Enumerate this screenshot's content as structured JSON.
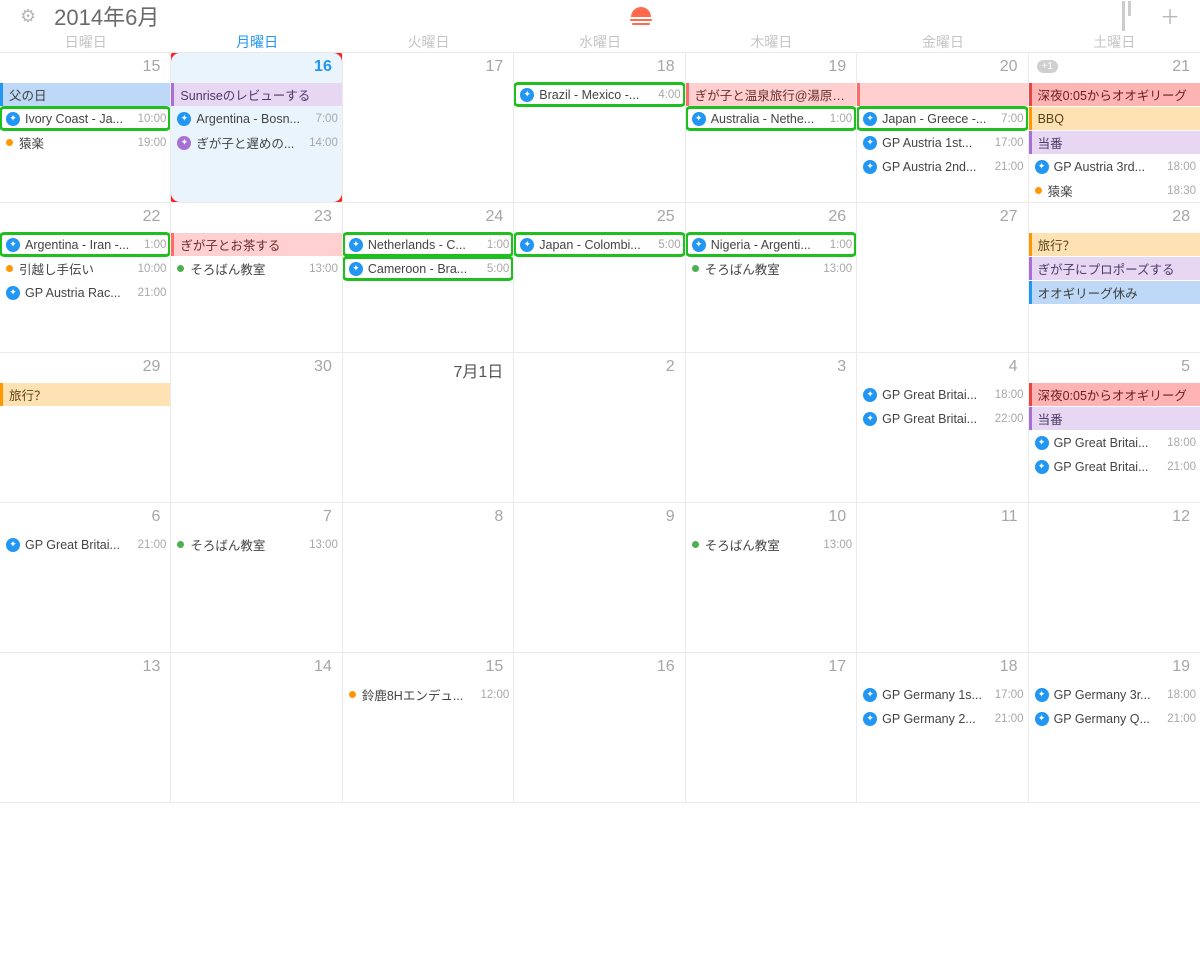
{
  "title": "2014年6月",
  "weekdays": [
    "日曜日",
    "月曜日",
    "火曜日",
    "水曜日",
    "木曜日",
    "金曜日",
    "土曜日"
  ],
  "activeWeekdayIndex": 1,
  "cells": [
    {
      "num": "15",
      "events": [
        {
          "style": "bar-blue",
          "title": "父の日"
        },
        {
          "style": "hl-green",
          "icon": "ic-blue",
          "title": "Ivory Coast - Ja...",
          "time": "10:00"
        },
        {
          "dot": "d-orange",
          "title": "猿楽",
          "time": "19:00"
        }
      ]
    },
    {
      "num": "16",
      "today": true,
      "events": [
        {
          "style": "bar-purple",
          "title": "Sunriseのレビューする"
        },
        {
          "icon": "ic-blue",
          "title": "Argentina - Bosn...",
          "time": "7:00"
        },
        {
          "icon": "ic-purple",
          "title": "ぎが子と遅めの...",
          "time": "14:00"
        }
      ]
    },
    {
      "num": "17",
      "events": []
    },
    {
      "num": "18",
      "events": [
        {
          "style": "hl-green",
          "icon": "ic-blue",
          "title": "Brazil - Mexico -...",
          "time": "4:00"
        }
      ]
    },
    {
      "num": "19",
      "events": [
        {
          "style": "bar-pink",
          "title": "ぎが子と温泉旅行@湯原温泉"
        },
        {
          "style": "hl-green",
          "icon": "ic-blue",
          "title": "Australia - Nethe...",
          "time": "1:00"
        }
      ]
    },
    {
      "num": "20",
      "events": [
        {
          "style": "bar-pink",
          "title": " ",
          "span": true
        },
        {
          "style": "hl-green",
          "icon": "ic-blue",
          "title": "Japan - Greece -...",
          "time": "7:00"
        },
        {
          "icon": "ic-blue",
          "title": "GP Austria 1st...",
          "time": "17:00"
        },
        {
          "icon": "ic-blue",
          "title": "GP Austria 2nd...",
          "time": "21:00"
        }
      ]
    },
    {
      "num": "21",
      "overflow": "+1",
      "events": [
        {
          "style": "bar-red",
          "title": "深夜0:05からオオギリーグ"
        },
        {
          "style": "bar-orange",
          "title": "BBQ"
        },
        {
          "style": "bar-purple",
          "title": "当番"
        },
        {
          "icon": "ic-blue",
          "title": "GP Austria 3rd...",
          "time": "18:00"
        },
        {
          "dot": "d-orange",
          "title": "猿楽",
          "time": "18:30"
        }
      ]
    },
    {
      "num": "22",
      "events": [
        {
          "style": "hl-green",
          "icon": "ic-blue",
          "title": "Argentina - Iran -...",
          "time": "1:00"
        },
        {
          "dot": "d-orange",
          "title": "引越し手伝い",
          "time": "10:00"
        },
        {
          "icon": "ic-blue",
          "title": "GP Austria Rac...",
          "time": "21:00"
        }
      ]
    },
    {
      "num": "23",
      "events": [
        {
          "style": "bar-pink",
          "title": "ぎが子とお茶する"
        },
        {
          "dot": "d-green",
          "title": "そろばん教室",
          "time": "13:00"
        }
      ]
    },
    {
      "num": "24",
      "events": [
        {
          "style": "hl-green",
          "icon": "ic-blue",
          "title": "Netherlands - C...",
          "time": "1:00"
        },
        {
          "style": "hl-green",
          "icon": "ic-blue",
          "title": "Cameroon - Bra...",
          "time": "5:00"
        }
      ]
    },
    {
      "num": "25",
      "events": [
        {
          "style": "hl-green",
          "icon": "ic-blue",
          "title": "Japan - Colombi...",
          "time": "5:00"
        }
      ]
    },
    {
      "num": "26",
      "events": [
        {
          "style": "hl-green",
          "icon": "ic-blue",
          "title": "Nigeria - Argenti...",
          "time": "1:00"
        },
        {
          "dot": "d-green",
          "title": "そろばん教室",
          "time": "13:00"
        }
      ]
    },
    {
      "num": "27",
      "events": []
    },
    {
      "num": "28",
      "events": [
        {
          "style": "bar-orange",
          "title": "旅行？"
        },
        {
          "style": "bar-purple",
          "title": "ぎが子にプロポーズする"
        },
        {
          "style": "bar-blue",
          "title": "オオギリーグ休み"
        }
      ]
    },
    {
      "num": "29",
      "events": [
        {
          "style": "bar-orange",
          "title": "旅行？"
        }
      ]
    },
    {
      "num": "30",
      "events": []
    },
    {
      "num": "7月1日",
      "monthstart": true,
      "events": []
    },
    {
      "num": "2",
      "events": []
    },
    {
      "num": "3",
      "events": []
    },
    {
      "num": "4",
      "events": [
        {
          "icon": "ic-blue",
          "title": "GP Great Britai...",
          "time": "18:00"
        },
        {
          "icon": "ic-blue",
          "title": "GP Great Britai...",
          "time": "22:00"
        }
      ]
    },
    {
      "num": "5",
      "events": [
        {
          "style": "bar-red",
          "title": "深夜0:05からオオギリーグ"
        },
        {
          "style": "bar-purple",
          "title": "当番"
        },
        {
          "icon": "ic-blue",
          "title": "GP Great Britai...",
          "time": "18:00"
        },
        {
          "icon": "ic-blue",
          "title": "GP Great Britai...",
          "time": "21:00"
        }
      ]
    },
    {
      "num": "6",
      "events": [
        {
          "icon": "ic-blue",
          "title": "GP Great Britai...",
          "time": "21:00"
        }
      ]
    },
    {
      "num": "7",
      "events": [
        {
          "dot": "d-green",
          "title": "そろばん教室",
          "time": "13:00"
        }
      ]
    },
    {
      "num": "8",
      "events": []
    },
    {
      "num": "9",
      "events": []
    },
    {
      "num": "10",
      "events": [
        {
          "dot": "d-green",
          "title": "そろばん教室",
          "time": "13:00"
        }
      ]
    },
    {
      "num": "11",
      "events": []
    },
    {
      "num": "12",
      "events": []
    },
    {
      "num": "13",
      "events": []
    },
    {
      "num": "14",
      "events": []
    },
    {
      "num": "15",
      "events": [
        {
          "dot": "d-orange",
          "title": "鈴鹿8Hエンデュ...",
          "time": "12:00"
        }
      ]
    },
    {
      "num": "16",
      "events": []
    },
    {
      "num": "17",
      "events": []
    },
    {
      "num": "18",
      "events": [
        {
          "icon": "ic-blue",
          "title": "GP Germany 1s...",
          "time": "17:00"
        },
        {
          "icon": "ic-blue",
          "title": "GP Germany 2...",
          "time": "21:00"
        }
      ]
    },
    {
      "num": "19",
      "events": [
        {
          "icon": "ic-blue",
          "title": "GP Germany 3r...",
          "time": "18:00"
        },
        {
          "icon": "ic-blue",
          "title": "GP Germany Q...",
          "time": "21:00"
        }
      ]
    }
  ]
}
